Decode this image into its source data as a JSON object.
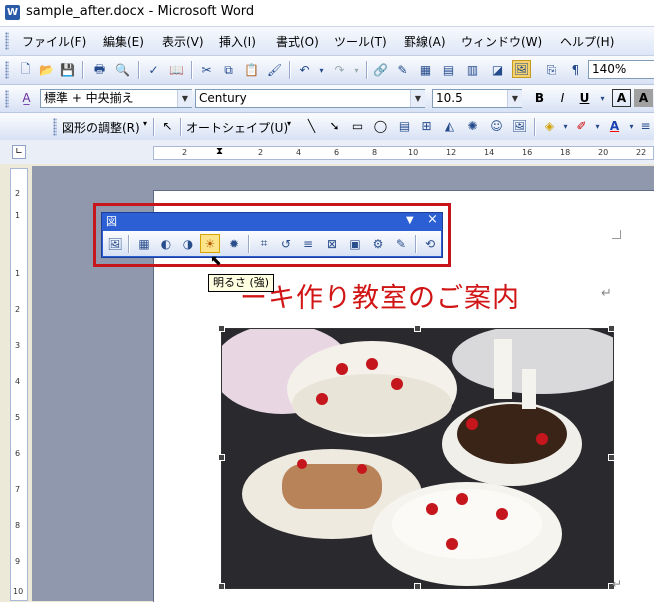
{
  "window": {
    "title": "sample_after.docx - Microsoft Word",
    "app_icon_letter": "W"
  },
  "menu": {
    "items": [
      "ファイル(F)",
      "編集(E)",
      "表示(V)",
      "挿入(I)",
      "書式(O)",
      "ツール(T)",
      "罫線(A)",
      "ウィンドウ(W)",
      "ヘルプ(H)"
    ]
  },
  "standard_toolbar": {
    "zoom": "140%"
  },
  "formatting_toolbar": {
    "style": "標準 + 中央揃え",
    "font": "Century",
    "size": "10.5",
    "bold": "B",
    "italic": "I",
    "underline": "U",
    "font_color_glyph": "A",
    "char_shade_glyph": "A"
  },
  "drawing_toolbar": {
    "draw_menu": "図形の調整(R)",
    "autoshape_menu": "オートシェイプ(U)"
  },
  "ruler": {
    "h_ticks": [
      "2",
      "2",
      "4",
      "6",
      "8",
      "10",
      "12",
      "14",
      "16",
      "18",
      "20",
      "22"
    ],
    "v_ticks": [
      "2",
      "1",
      "1",
      "2",
      "3",
      "4",
      "5",
      "6",
      "7",
      "8",
      "9",
      "10"
    ]
  },
  "document": {
    "title": "ーキ作り教室のご案内",
    "para_mark": "↵"
  },
  "picture_toolbar": {
    "title": "図",
    "menu_arrow": "▼",
    "close": "×"
  },
  "tooltip": {
    "text": "明るさ (強)"
  },
  "colors": {
    "title_red": "#d11515",
    "toolbar_blue": "#2c5fd4",
    "highlight_red": "#c8151b"
  }
}
